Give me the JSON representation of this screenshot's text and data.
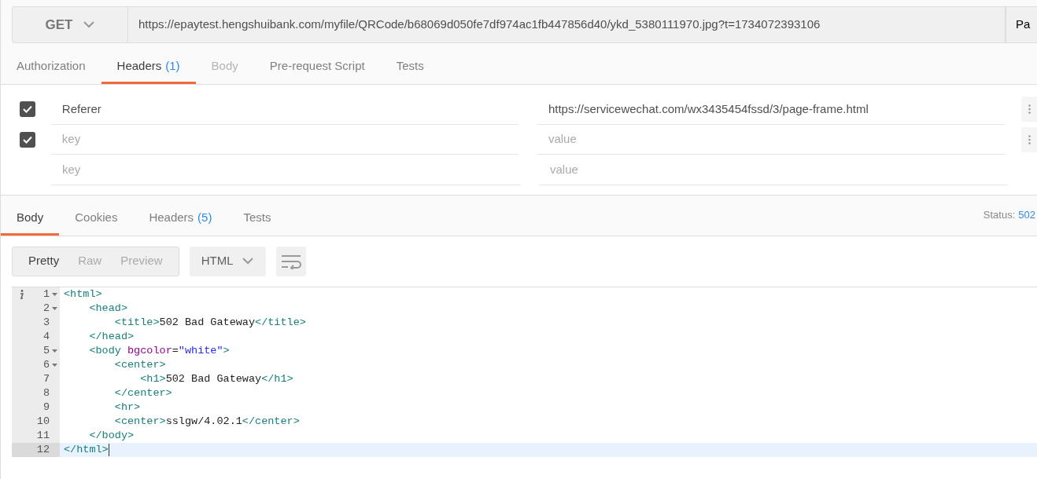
{
  "request": {
    "method": "GET",
    "url": "https://epaytest.hengshuibank.com/myfile/QRCode/b68069d050fe7df974ac1fb447856d40/ykd_5380111970.jpg?t=1734072393106",
    "side_button": "Pa"
  },
  "request_tabs": [
    {
      "label": "Authorization",
      "selected": false,
      "disabled": false
    },
    {
      "label": "Headers",
      "count": "(1)",
      "selected": true,
      "disabled": false
    },
    {
      "label": "Body",
      "selected": false,
      "disabled": true
    },
    {
      "label": "Pre-request Script",
      "selected": false,
      "disabled": false
    },
    {
      "label": "Tests",
      "selected": false,
      "disabled": false
    }
  ],
  "headers": [
    {
      "checked": true,
      "key": "Referer",
      "value": "https://servicewechat.com/wx3435454fssd/3/page-frame.html"
    },
    {
      "checked": true,
      "key_placeholder": "key",
      "value_placeholder": "value"
    },
    {
      "key_placeholder": "key",
      "value_placeholder": "value"
    }
  ],
  "response_tabs": [
    {
      "label": "Body",
      "selected": true
    },
    {
      "label": "Cookies",
      "selected": false
    },
    {
      "label": "Headers",
      "count": "(5)",
      "selected": false
    },
    {
      "label": "Tests",
      "selected": false
    }
  ],
  "status": {
    "label": "Status:",
    "value": "502"
  },
  "view_modes": [
    {
      "label": "Pretty",
      "selected": true
    },
    {
      "label": "Raw",
      "selected": false
    },
    {
      "label": "Preview",
      "selected": false
    }
  ],
  "format": "HTML",
  "code_lines": [
    {
      "number": "1",
      "foldable": true,
      "active": false,
      "info": true,
      "tokens": [
        {
          "kind": "tag",
          "text": "<html>"
        }
      ]
    },
    {
      "number": "2",
      "foldable": true,
      "active": false,
      "tokens": [
        {
          "kind": "tag",
          "text": "    <head>"
        }
      ]
    },
    {
      "number": "3",
      "foldable": false,
      "active": false,
      "info": false,
      "tokens": [
        {
          "kind": "tag",
          "text": "        <title>"
        },
        {
          "kind": "text",
          "text": "502 Bad Gateway"
        },
        {
          "kind": "tag",
          "text": "</title>"
        }
      ]
    },
    {
      "number": "4",
      "foldable": false,
      "active": false,
      "info": false,
      "tokens": [
        {
          "kind": "tag",
          "text": "    </head>"
        }
      ]
    },
    {
      "number": "5",
      "foldable": true,
      "active": false,
      "info": false,
      "tokens": [
        {
          "kind": "tag",
          "text": "    <body"
        },
        {
          "kind": "attr",
          "text": " bgcolor"
        },
        {
          "kind": "text",
          "text": "="
        },
        {
          "kind": "string",
          "text": "\"white\""
        },
        {
          "kind": "tag",
          "text": ">"
        }
      ]
    },
    {
      "number": "6",
      "foldable": true,
      "active": false,
      "info": false,
      "tokens": [
        {
          "kind": "tag",
          "text": "        <center>"
        }
      ]
    },
    {
      "number": "7",
      "foldable": false,
      "active": false,
      "info": false,
      "tokens": [
        {
          "kind": "tag",
          "text": "            <h1>"
        },
        {
          "kind": "text",
          "text": "502 Bad Gateway"
        },
        {
          "kind": "tag",
          "text": "</h1>"
        }
      ]
    },
    {
      "number": "8",
      "foldable": false,
      "active": false,
      "info": false,
      "tokens": [
        {
          "kind": "tag",
          "text": "        </center>"
        }
      ]
    },
    {
      "number": "9",
      "foldable": false,
      "active": false,
      "info": false,
      "tokens": [
        {
          "kind": "tag",
          "text": "        <hr>"
        }
      ]
    },
    {
      "number": "10",
      "foldable": false,
      "active": false,
      "info": false,
      "tokens": [
        {
          "kind": "tag",
          "text": "        <center>"
        },
        {
          "kind": "text",
          "text": "sslgw/4.02.1"
        },
        {
          "kind": "tag",
          "text": "</center>"
        }
      ]
    },
    {
      "number": "11",
      "foldable": false,
      "active": false,
      "info": false,
      "tokens": [
        {
          "kind": "tag",
          "text": "    </body>"
        }
      ]
    },
    {
      "number": "12",
      "foldable": false,
      "active": true,
      "info": false,
      "tokens": [
        {
          "kind": "tag",
          "text": "</html>"
        }
      ]
    }
  ]
}
